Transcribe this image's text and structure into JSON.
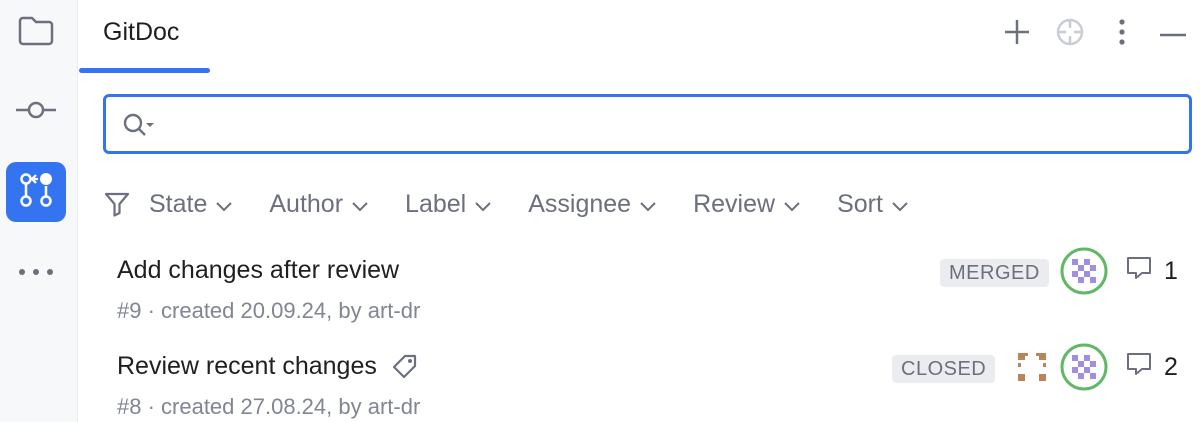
{
  "sidebar": {
    "items": [
      {
        "name": "project",
        "icon": "folder-icon"
      },
      {
        "name": "commit",
        "icon": "commit-icon"
      },
      {
        "name": "pull-requests",
        "icon": "pull-request-icon",
        "active": true
      },
      {
        "name": "more",
        "icon": "more-horizontal-icon"
      }
    ]
  },
  "header": {
    "tab_label": "GitDoc",
    "actions": [
      "add-icon",
      "locate-icon",
      "more-vertical-icon",
      "minimize-icon"
    ]
  },
  "search": {
    "value": "",
    "placeholder": ""
  },
  "filters": [
    {
      "label": "State"
    },
    {
      "label": "Author"
    },
    {
      "label": "Label"
    },
    {
      "label": "Assignee"
    },
    {
      "label": "Review"
    },
    {
      "label": "Sort"
    }
  ],
  "pull_requests": [
    {
      "title": "Add changes after review",
      "meta": "#9 · created 20.09.24, by art-dr",
      "state": "MERGED",
      "comment_count": "1",
      "has_label": false
    },
    {
      "title": "Review recent changes",
      "meta": "#8 · created 27.08.24, by art-dr",
      "state": "CLOSED",
      "comment_count": "2",
      "has_label": true
    }
  ],
  "colors": {
    "accent": "#3574f0",
    "avatar_ring": "#5fb865",
    "avatar_pattern": "#a08fe0",
    "avatar2_pattern": "#b8845a"
  }
}
